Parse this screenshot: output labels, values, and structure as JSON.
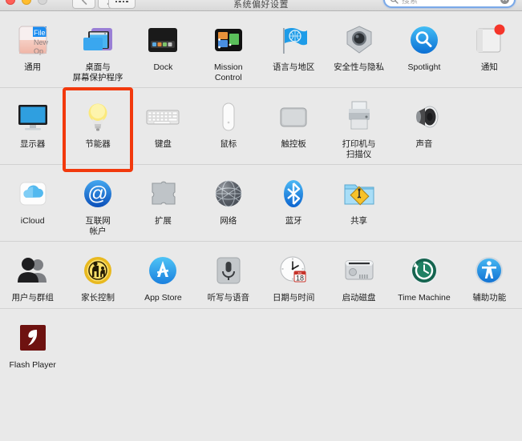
{
  "window": {
    "title": "系统偏好设置",
    "traffic_lights": [
      "close",
      "minimize",
      "zoom"
    ],
    "nav": {
      "back_label": "‹",
      "forward_label": "›",
      "grid_label": "grid-view"
    },
    "accent_red": "#f2390d",
    "search_focus_color": "#7aa9e8"
  },
  "search": {
    "placeholder": "搜索",
    "value": "",
    "clear_label": "✕"
  },
  "rows": [
    {
      "items": [
        {
          "label": "通用",
          "icon": "general-icon"
        },
        {
          "label": "桌面与\n屏幕保护程序",
          "icon": "desktop-screensaver-icon"
        },
        {
          "label": "Dock",
          "icon": "dock-icon"
        },
        {
          "label": "Mission\nControl",
          "icon": "mission-control-icon"
        },
        {
          "label": "语言与地区",
          "icon": "language-region-icon"
        },
        {
          "label": "安全性与隐私",
          "icon": "security-privacy-icon"
        },
        {
          "label": "Spotlight",
          "icon": "spotlight-icon"
        },
        {
          "label": "通知",
          "icon": "notifications-icon",
          "badge": true
        }
      ]
    },
    {
      "items": [
        {
          "label": "显示器",
          "icon": "displays-icon"
        },
        {
          "label": "节能器",
          "icon": "energy-saver-icon",
          "highlighted": true
        },
        {
          "label": "键盘",
          "icon": "keyboard-icon"
        },
        {
          "label": "鼠标",
          "icon": "mouse-icon"
        },
        {
          "label": "触控板",
          "icon": "trackpad-icon"
        },
        {
          "label": "打印机与\n扫描仪",
          "icon": "printers-scanners-icon"
        },
        {
          "label": "声音",
          "icon": "sound-icon"
        },
        {
          "label": "",
          "icon": "",
          "empty": true
        }
      ]
    },
    {
      "items": [
        {
          "label": "iCloud",
          "icon": "icloud-icon"
        },
        {
          "label": "互联网\n帐户",
          "icon": "internet-accounts-icon"
        },
        {
          "label": "扩展",
          "icon": "extensions-icon"
        },
        {
          "label": "网络",
          "icon": "network-icon"
        },
        {
          "label": "蓝牙",
          "icon": "bluetooth-icon"
        },
        {
          "label": "共享",
          "icon": "sharing-icon"
        },
        {
          "label": "",
          "icon": "",
          "empty": true
        },
        {
          "label": "",
          "icon": "",
          "empty": true
        }
      ]
    },
    {
      "items": [
        {
          "label": "用户与群组",
          "icon": "users-groups-icon"
        },
        {
          "label": "家长控制",
          "icon": "parental-controls-icon"
        },
        {
          "label": "App Store",
          "icon": "app-store-icon"
        },
        {
          "label": "听写与语音",
          "icon": "dictation-speech-icon"
        },
        {
          "label": "日期与时间",
          "icon": "date-time-icon",
          "calendar_day": "18",
          "calendar_month": "JUL"
        },
        {
          "label": "启动磁盘",
          "icon": "startup-disk-icon"
        },
        {
          "label": "Time Machine",
          "icon": "time-machine-icon"
        },
        {
          "label": "辅助功能",
          "icon": "accessibility-icon"
        }
      ]
    },
    {
      "items": [
        {
          "label": "Flash Player",
          "icon": "flash-player-icon"
        },
        {
          "label": "",
          "icon": "",
          "empty": true
        },
        {
          "label": "",
          "icon": "",
          "empty": true
        },
        {
          "label": "",
          "icon": "",
          "empty": true
        },
        {
          "label": "",
          "icon": "",
          "empty": true
        },
        {
          "label": "",
          "icon": "",
          "empty": true
        },
        {
          "label": "",
          "icon": "",
          "empty": true
        },
        {
          "label": "",
          "icon": "",
          "empty": true
        }
      ]
    }
  ]
}
